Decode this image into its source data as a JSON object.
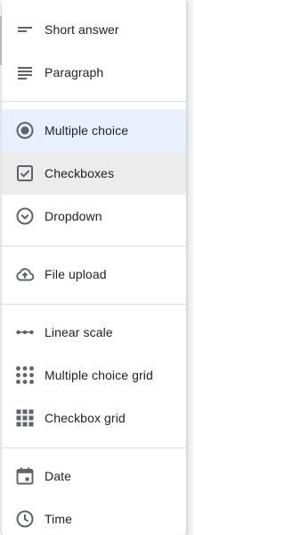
{
  "menu": {
    "items": [
      {
        "label": "Short answer",
        "icon": "short-answer-icon"
      },
      {
        "label": "Paragraph",
        "icon": "paragraph-icon"
      },
      {
        "label": "Multiple choice",
        "icon": "radio-button-icon",
        "state": "selected"
      },
      {
        "label": "Checkboxes",
        "icon": "checkbox-icon",
        "state": "hover"
      },
      {
        "label": "Dropdown",
        "icon": "dropdown-circle-icon"
      },
      {
        "label": "File upload",
        "icon": "cloud-upload-icon"
      },
      {
        "label": "Linear scale",
        "icon": "linear-scale-icon"
      },
      {
        "label": "Multiple choice grid",
        "icon": "dot-grid-icon"
      },
      {
        "label": "Checkbox grid",
        "icon": "square-grid-icon"
      },
      {
        "label": "Date",
        "icon": "calendar-icon"
      },
      {
        "label": "Time",
        "icon": "clock-icon"
      }
    ]
  },
  "colors": {
    "icon": "#5f6368",
    "text": "#202124",
    "selected_background": "#e8f0fe",
    "hover_background": "#ececec",
    "divider": "#dadce0"
  }
}
